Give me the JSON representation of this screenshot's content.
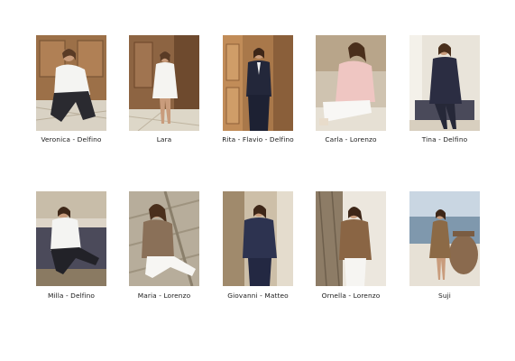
{
  "lookbook": {
    "items": [
      {
        "caption": "Veronica - Delfino",
        "scene": "wood-panel-white-shirt"
      },
      {
        "caption": "Lara",
        "scene": "wood-door-white-shirtdress"
      },
      {
        "caption": "Rita - Flavio - Delfino",
        "scene": "wood-door-navy-suit"
      },
      {
        "caption": "Carla - Lorenzo",
        "scene": "pink-shirt-seated"
      },
      {
        "caption": "Tina - Delfino",
        "scene": "navy-shirt-bench"
      },
      {
        "caption": "Milla - Delfino",
        "scene": "white-shirt-sofa"
      },
      {
        "caption": "Maria - Lorenzo",
        "scene": "beige-shirt-stairs"
      },
      {
        "caption": "Giovanni - Matteo",
        "scene": "navy-silk-column"
      },
      {
        "caption": "Ornella - Lorenzo",
        "scene": "brown-shirt-column"
      },
      {
        "caption": "Suji",
        "scene": "sea-view-dress"
      }
    ]
  }
}
